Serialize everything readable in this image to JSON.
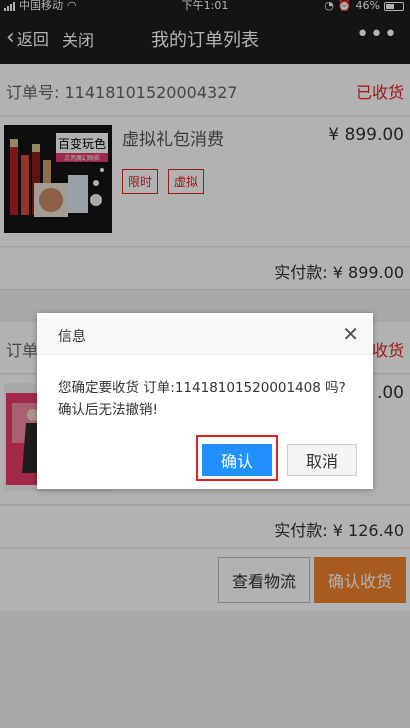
{
  "status_bar": {
    "carrier": "中国移动",
    "time": "下午1:01",
    "battery": "46%"
  },
  "nav": {
    "back_label": "返回",
    "close_label": "关闭",
    "title": "我的订单列表",
    "more_icon": "more-dots-icon"
  },
  "orders": [
    {
      "order_no_label": "订单号:",
      "order_no": "11418101520004327",
      "status": "已收货",
      "product_name": "虚拟礼包消费",
      "price": "¥ 899.00",
      "tags": [
        "限时",
        "虚拟"
      ],
      "thumb_text": "百变玩色",
      "thumb_sub": "点亮魔幻眼影",
      "pay_label": "实付款:",
      "pay_amount": "¥ 899.00"
    },
    {
      "order_no_label": "订单",
      "status": "收货",
      "price": ".00",
      "pay_label": "实付款:",
      "pay_amount": "¥ 126.40"
    }
  ],
  "actions": {
    "logistics": "查看物流",
    "confirm_receipt": "确认收货"
  },
  "dialog": {
    "title": "信息",
    "message_line1": "您确定要收货 订单:11418101520001408 吗?",
    "message_line2": "确认后无法撤销!",
    "ok": "确认",
    "cancel": "取消"
  },
  "colors": {
    "accent_red": "#e02424",
    "confirm_orange": "#f0832b",
    "dialog_blue": "#1e90ff",
    "nav_dark": "#1e1e1e"
  }
}
